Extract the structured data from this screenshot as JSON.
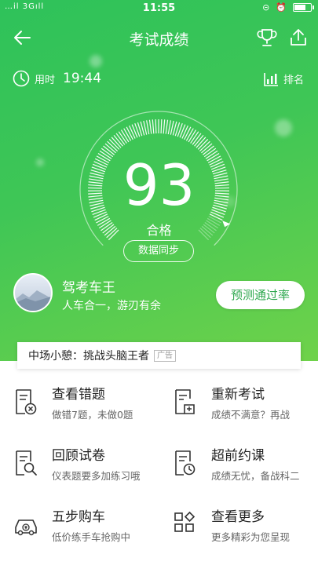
{
  "status_bar": {
    "time": "11:55",
    "left_indicators": "…il 3Gıll"
  },
  "nav": {
    "title": "考试成绩"
  },
  "timer": {
    "label": "用时",
    "value": "19:44"
  },
  "rank": {
    "label": "排名"
  },
  "result": {
    "score": "93",
    "status": "合格",
    "sync_label": "数据同步"
  },
  "user": {
    "name": "驾考车王",
    "motto": "人车合一，游刃有余",
    "predict_button": "预测通过率"
  },
  "ad": {
    "text": "中场小憩：挑战头脑王者",
    "tag": "广告"
  },
  "actions": [
    {
      "title": "查看错题",
      "subtitle": "做错7题，未做0题",
      "icon": "wrong-answers-icon"
    },
    {
      "title": "重新考试",
      "subtitle": "成绩不满意？再战",
      "icon": "retake-exam-icon"
    },
    {
      "title": "回顾试卷",
      "subtitle": "仪表题要多加练习哦",
      "icon": "review-paper-icon"
    },
    {
      "title": "超前约课",
      "subtitle": "成绩无忧，备战科二",
      "icon": "book-lesson-icon"
    },
    {
      "title": "五步购车",
      "subtitle": "低价练手车抢购中",
      "icon": "buy-car-icon"
    },
    {
      "title": "查看更多",
      "subtitle": "更多精彩为您呈现",
      "icon": "more-apps-icon"
    }
  ],
  "colors": {
    "accent": "#2fa84f",
    "hero_start": "#2ec25a",
    "hero_end": "#6fd24a"
  }
}
